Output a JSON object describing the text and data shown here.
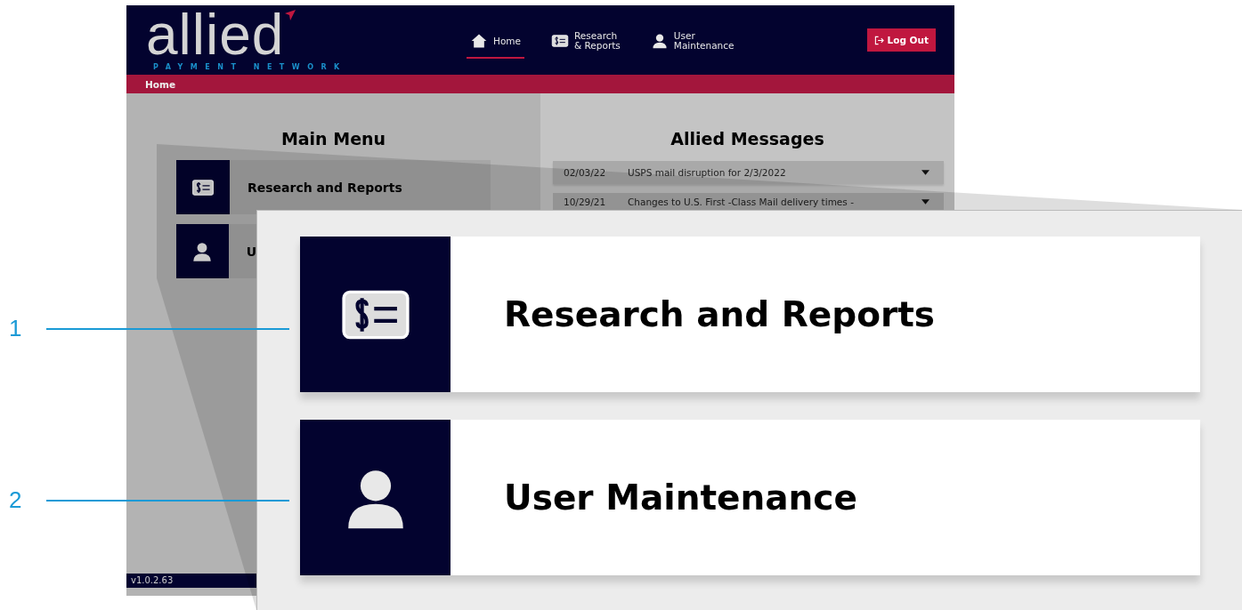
{
  "header": {
    "logo": {
      "wordmark": "allied",
      "tagline": "PAYMENT NETWORK"
    },
    "nav": [
      {
        "label": "Home",
        "kind": "home",
        "selected": true
      },
      {
        "label": "Research\n& Reports",
        "kind": "report",
        "selected": false
      },
      {
        "label": "User\nMaintenance",
        "kind": "user",
        "selected": false
      }
    ],
    "logout": "Log Out"
  },
  "breadcrumb": "Home",
  "main_menu": {
    "title": "Main Menu",
    "items": [
      {
        "label": "Research and Reports",
        "kind": "report"
      },
      {
        "label": "U",
        "kind": "user"
      }
    ]
  },
  "messages": {
    "title": "Allied Messages",
    "items": [
      {
        "date": "02/03/22",
        "text": "USPS mail disruption for 2/3/2022"
      },
      {
        "date": "10/29/21",
        "text": "Changes to U.S. First -Class Mail delivery times -"
      }
    ]
  },
  "version": "v1.0.2.63",
  "callout": {
    "items": [
      {
        "label": "Research and Reports",
        "kind": "report",
        "number": "1"
      },
      {
        "label": "User Maintenance",
        "kind": "user",
        "number": "2"
      }
    ]
  }
}
